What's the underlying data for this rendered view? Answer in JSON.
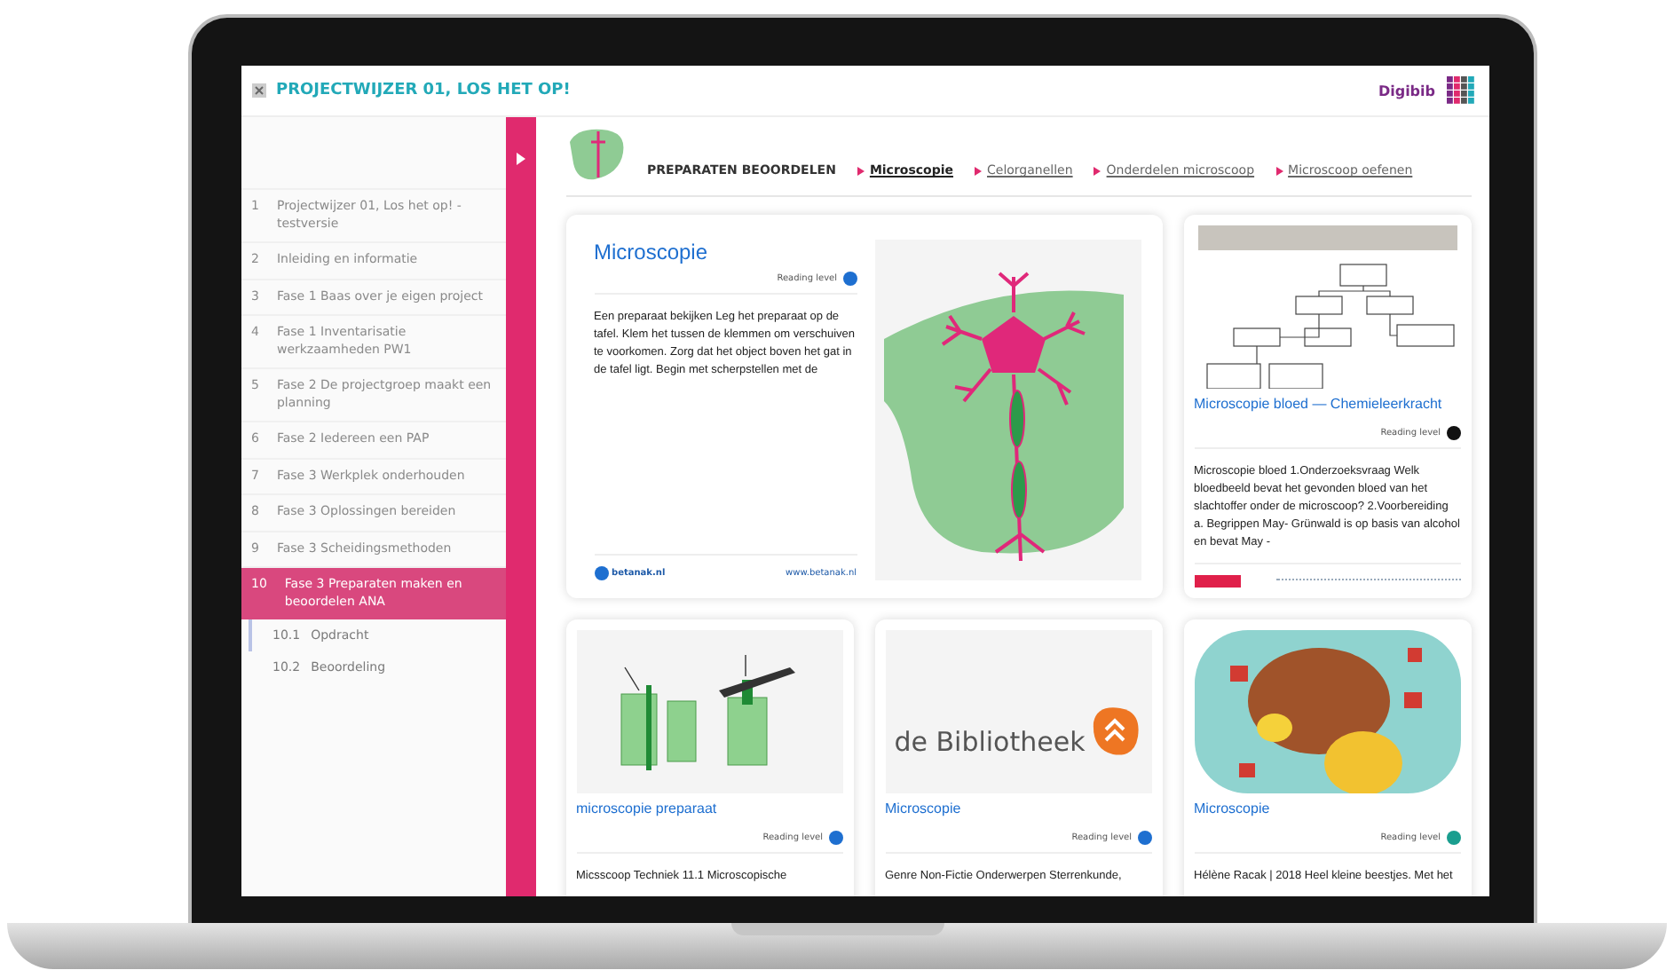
{
  "app": {
    "title": "PROJECTWIJZER 01, LOS HET OP!",
    "brand": "Digibib"
  },
  "sidebar": {
    "items": [
      {
        "number": "1",
        "label": "Projectwijzer 01, Los het op! - testversie",
        "selected": false
      },
      {
        "number": "2",
        "label": "Inleiding en informatie",
        "selected": false
      },
      {
        "number": "3",
        "label": "Fase 1 Baas over je eigen project",
        "selected": false
      },
      {
        "number": "4",
        "label": "Fase 1 Inventarisatie werkzaamheden PW1",
        "selected": false
      },
      {
        "number": "5",
        "label": "Fase 2 De projectgroep maakt een planning",
        "selected": false
      },
      {
        "number": "6",
        "label": "Fase 2 Iedereen een PAP",
        "selected": false
      },
      {
        "number": "7",
        "label": "Fase 3 Werkplek onderhouden",
        "selected": false
      },
      {
        "number": "8",
        "label": "Fase 3 Oplossingen bereiden",
        "selected": false
      },
      {
        "number": "9",
        "label": "Fase 3 Scheidingsmethoden",
        "selected": false
      },
      {
        "number": "10",
        "label": "Fase 3 Preparaten maken en beoordelen ANA",
        "selected": true,
        "children": [
          {
            "number": "10.1",
            "label": "Opdracht",
            "selected": true
          },
          {
            "number": "10.2",
            "label": "Beoordeling",
            "selected": false
          }
        ]
      }
    ]
  },
  "header": {
    "title": "PREPARATEN BEOORDELEN",
    "links": [
      {
        "label": "Microscopie",
        "selected": true
      },
      {
        "label": "Celorganellen",
        "selected": false
      },
      {
        "label": "Onderdelen microscoop",
        "selected": false
      },
      {
        "label": "Microscoop oefenen",
        "selected": false
      }
    ]
  },
  "cards": [
    {
      "kind": "featured",
      "title": "Microscopie",
      "reading": "Reading level",
      "color": "#1e6fd0",
      "text": "Een preparaat bekijken Leg het preparaat op de tafel. Klem het tussen de klemmen om verschuiven te voorkomen. Zorg dat het object boven het gat in de tafel ligt. Begin met scherpstellen met de",
      "logo": "betanak.nl",
      "url": "www.betanak.nl"
    },
    {
      "kind": "tall",
      "title": "Microscopie bloed — Chemieleerkracht",
      "reading": "Reading level",
      "color": "#111111",
      "text": "Microscopie bloed 1.Onderzoeksvraag Welk bloedbeeld bevat het gevonden bloed van het slachtoffer onder de microscoop? 2.Voorbereiding a. Begrippen May- Grünwald is op basis van alcohol en bevat May -"
    },
    {
      "kind": "small",
      "title": "microscopie preparaat",
      "reading": "Reading level",
      "color": "#1e6fd0",
      "text": "Micsscoop Techniek 11.1 Microscopische"
    },
    {
      "kind": "small",
      "image_text": "de Bibliotheek",
      "title": "Microscopie",
      "reading": "Reading level",
      "color": "#1e6fd0",
      "text": "Genre Non-Fictie Onderwerpen Sterrenkunde,"
    },
    {
      "kind": "small",
      "title": "Microscopie",
      "reading": "Reading level",
      "color": "#1a9e8f",
      "text": "Hélène Racak | 2018 Heel kleine beestjes. Met het"
    }
  ]
}
